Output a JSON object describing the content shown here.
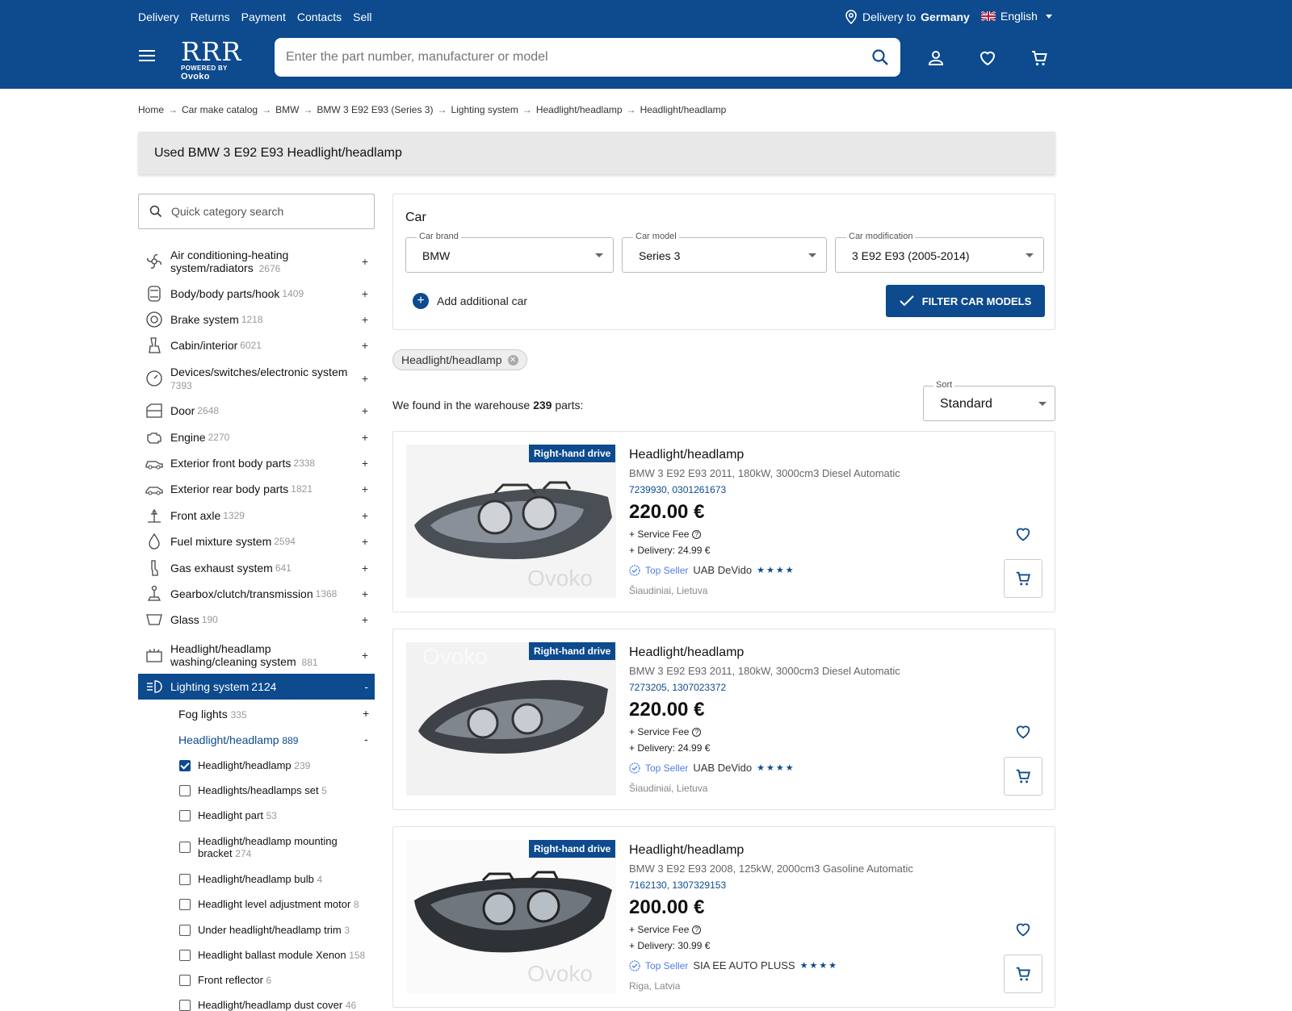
{
  "header": {
    "links": [
      "Delivery",
      "Returns",
      "Payment",
      "Contacts",
      "Sell"
    ],
    "delivery_prefix": "Delivery to",
    "delivery_country": "Germany",
    "language": "English",
    "logo_text": "RRR",
    "logo_powered": "POWERED BY",
    "logo_brand": "Ovoko",
    "search_placeholder": "Enter the part number, manufacturer or model"
  },
  "breadcrumb": [
    "Home",
    "Car make catalog",
    "BMW",
    "BMW 3 E92 E93 (Series 3)",
    "Lighting system",
    "Headlight/headlamp",
    "Headlight/headlamp"
  ],
  "page_title": "Used BMW 3 E92 E93 Headlight/headlamp",
  "sidebar": {
    "search_placeholder": "Quick category search",
    "categories": [
      {
        "name": "Air conditioning-heating system/radiators",
        "count": "2676"
      },
      {
        "name": "Body/body parts/hook",
        "count": "1409"
      },
      {
        "name": "Brake system",
        "count": "1218"
      },
      {
        "name": "Cabin/interior",
        "count": "6021"
      },
      {
        "name": "Devices/switches/electronic system",
        "count": "7393"
      },
      {
        "name": "Door",
        "count": "2648"
      },
      {
        "name": "Engine",
        "count": "2270"
      },
      {
        "name": "Exterior front body parts",
        "count": "2338"
      },
      {
        "name": "Exterior rear body parts",
        "count": "1821"
      },
      {
        "name": "Front axle",
        "count": "1329"
      },
      {
        "name": "Fuel mixture system",
        "count": "2594"
      },
      {
        "name": "Gas exhaust system",
        "count": "641"
      },
      {
        "name": "Gearbox/clutch/transmission",
        "count": "1368"
      },
      {
        "name": "Glass",
        "count": "190"
      },
      {
        "name": "Headlight/headlamp washing/cleaning system",
        "count": "881"
      },
      {
        "name": "Lighting system",
        "count": "2124"
      }
    ],
    "subcategories": [
      {
        "name": "Fog lights",
        "count": "335"
      },
      {
        "name": "Headlight/headlamp",
        "count": "889"
      }
    ],
    "leaves": [
      {
        "name": "Headlight/headlamp",
        "count": "239",
        "checked": true
      },
      {
        "name": "Headlights/headlamps set",
        "count": "5",
        "checked": false
      },
      {
        "name": "Headlight part",
        "count": "53",
        "checked": false
      },
      {
        "name": "Headlight/headlamp mounting bracket",
        "count": "274",
        "checked": false
      },
      {
        "name": "Headlight/headlamp bulb",
        "count": "4",
        "checked": false
      },
      {
        "name": "Headlight level adjustment motor",
        "count": "8",
        "checked": false
      },
      {
        "name": "Under headlight/headlamp trim",
        "count": "3",
        "checked": false
      },
      {
        "name": "Headlight ballast module Xenon",
        "count": "158",
        "checked": false
      },
      {
        "name": "Front reflector",
        "count": "6",
        "checked": false
      },
      {
        "name": "Headlight/headlamp dust cover",
        "count": "46",
        "checked": false
      }
    ]
  },
  "car_filter": {
    "title": "Car",
    "brand_label": "Car brand",
    "brand_value": "BMW",
    "model_label": "Car model",
    "model_value": "Series 3",
    "mod_label": "Car modification",
    "mod_value": "3 E92 E93 (2005-2014)",
    "add_car": "Add additional car",
    "filter_button": "FILTER CAR MODELS"
  },
  "active_chip": "Headlight/headlamp",
  "results": {
    "found_prefix": "We found in the warehouse",
    "found_count": "239",
    "found_suffix": "parts:",
    "sort_label": "Sort",
    "sort_value": "Standard"
  },
  "products": [
    {
      "badge": "Right-hand drive",
      "title": "Headlight/headlamp",
      "desc": "BMW 3 E92 E93 2011, 180kW, 3000cm3 Diesel Automatic",
      "codes": "7239930, 0301261673",
      "price": "220.00 €",
      "service_fee": "+ Service Fee",
      "delivery": "+ Delivery: 24.99 €",
      "top_seller": "Top Seller",
      "seller": "UAB DeVido",
      "stars": "★★★★",
      "location": "Šiaudiniai, Lietuva"
    },
    {
      "badge": "Right-hand drive",
      "title": "Headlight/headlamp",
      "desc": "BMW 3 E92 E93 2011, 180kW, 3000cm3 Diesel Automatic",
      "codes": "7273205, 1307023372",
      "price": "220.00 €",
      "service_fee": "+ Service Fee",
      "delivery": "+ Delivery: 24.99 €",
      "top_seller": "Top Seller",
      "seller": "UAB DeVido",
      "stars": "★★★★",
      "location": "Šiaudiniai, Lietuva"
    },
    {
      "badge": "Right-hand drive",
      "title": "Headlight/headlamp",
      "desc": "BMW 3 E92 E93 2008, 125kW, 2000cm3 Gasoline Automatic",
      "codes": "7162130, 1307329153",
      "price": "200.00 €",
      "service_fee": "+ Service Fee",
      "delivery": "+ Delivery: 30.99 €",
      "top_seller": "Top Seller",
      "seller": "SIA EE AUTO PLUSS",
      "stars": "★★★★",
      "location": "Riga, Latvia"
    }
  ],
  "colors": {
    "brand": "#0d4a8e",
    "top_seller": "#4e7ee0"
  }
}
